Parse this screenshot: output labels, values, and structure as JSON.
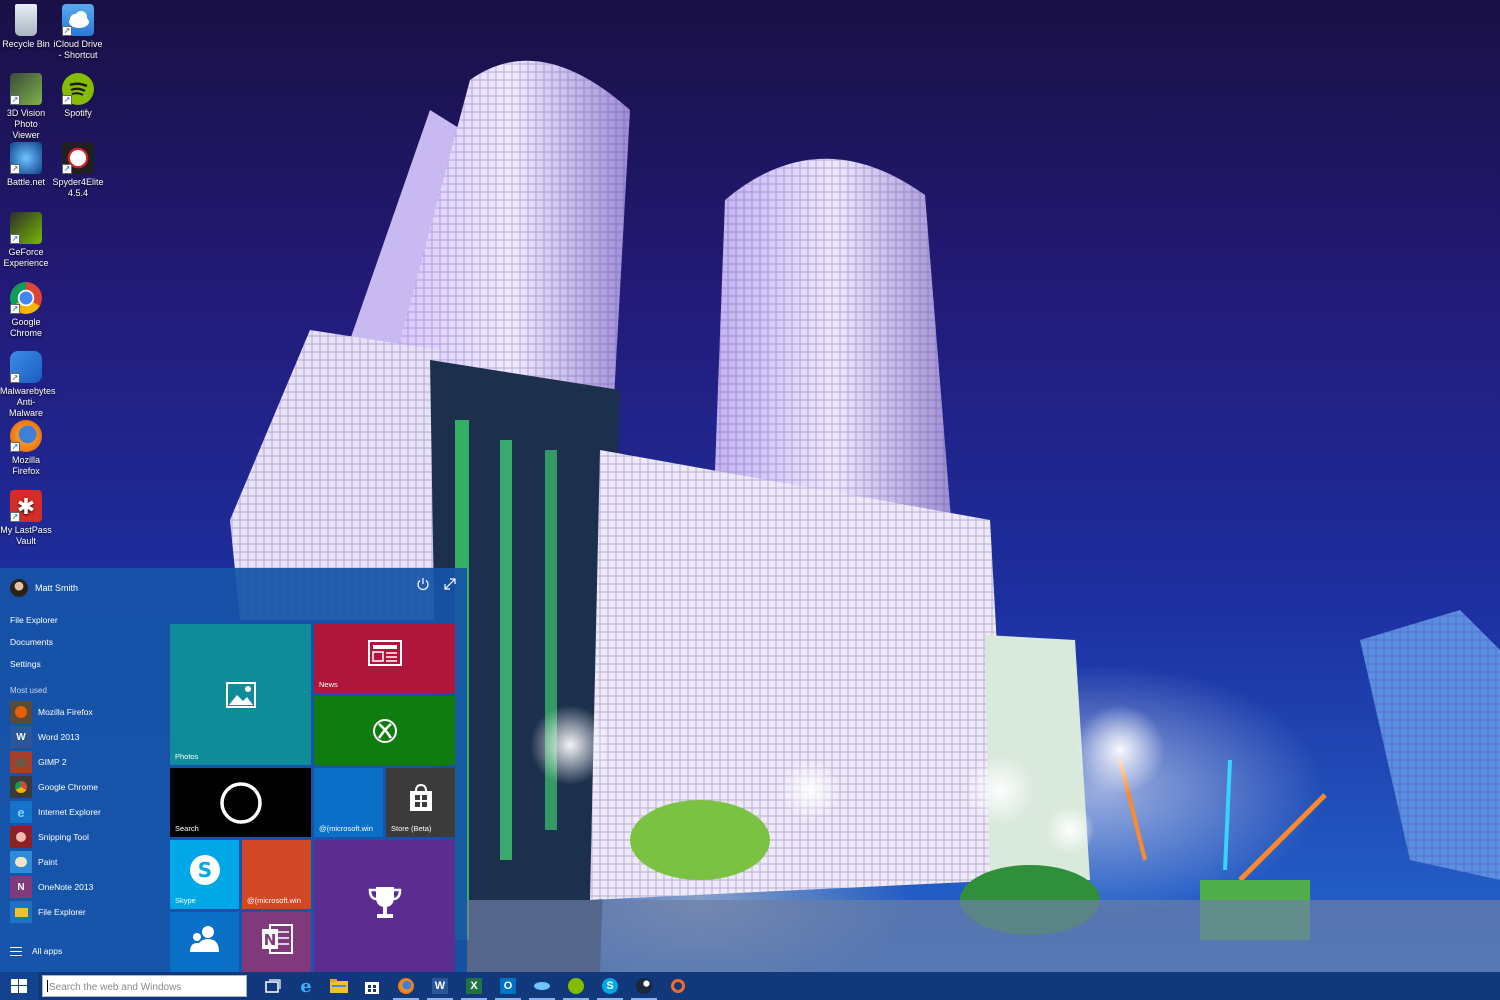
{
  "desktop": {
    "icons": [
      {
        "label": "Recycle Bin",
        "icon": "recycle-bin-icon"
      },
      {
        "label": "iCloud Drive - Shortcut",
        "icon": "icloud-icon"
      },
      {
        "label": "3D Vision Photo Viewer",
        "icon": "3d-vision-icon"
      },
      {
        "label": "Spotify",
        "icon": "spotify-icon"
      },
      {
        "label": "Battle.net",
        "icon": "battlenet-icon"
      },
      {
        "label": "Spyder4Elite 4.5.4",
        "icon": "spyder-icon"
      },
      {
        "label": "GeForce Experience",
        "icon": "geforce-icon"
      },
      {
        "label": "Google Chrome",
        "icon": "chrome-icon"
      },
      {
        "label": "Malwarebytes Anti-Malware",
        "icon": "malwarebytes-icon"
      },
      {
        "label": "Mozilla Firefox",
        "icon": "firefox-icon"
      },
      {
        "label": "My LastPass Vault",
        "icon": "lastpass-icon"
      }
    ]
  },
  "start_menu": {
    "user_name": "Matt Smith",
    "places": [
      "File Explorer",
      "Documents",
      "Settings"
    ],
    "most_used_header": "Most used",
    "most_used": [
      {
        "label": "Mozilla Firefox",
        "icon": "firefox-icon",
        "color": "#e66000"
      },
      {
        "label": "Word 2013",
        "icon": "word-icon",
        "color": "#2b579a"
      },
      {
        "label": "GIMP 2",
        "icon": "gimp-icon",
        "color": "#6b5a48"
      },
      {
        "label": "Google Chrome",
        "icon": "chrome-icon",
        "color": "#4caf50"
      },
      {
        "label": "Internet Explorer",
        "icon": "ie-icon",
        "color": "#1ea1f1"
      },
      {
        "label": "Snipping Tool",
        "icon": "snipping-tool-icon",
        "color": "#b0262b"
      },
      {
        "label": "Paint",
        "icon": "paint-icon",
        "color": "#2f8bd8"
      },
      {
        "label": "OneNote 2013",
        "icon": "onenote-icon",
        "color": "#80397b"
      },
      {
        "label": "File Explorer",
        "icon": "file-explorer-icon",
        "color": "#f0c030"
      }
    ],
    "all_apps": "All apps",
    "tiles": {
      "photos": {
        "label": "Photos",
        "color": "#0e8c9a"
      },
      "news": {
        "label": "News",
        "color": "#b0163c"
      },
      "xbox": {
        "label": "",
        "color": "#107c10"
      },
      "search": {
        "label": "Search",
        "color": "#000000"
      },
      "mail": {
        "label": "@{microsoft.win",
        "color": "#0a6fc6"
      },
      "store": {
        "label": "Store (Beta)",
        "color": "#3b3b3b"
      },
      "skype": {
        "label": "Skype",
        "color": "#00a8e8"
      },
      "calendar": {
        "label": "@{microsoft.win",
        "color": "#d24726"
      },
      "achievements": {
        "label": "",
        "color": "#5c2d91"
      },
      "people": {
        "label": "",
        "color": "#0a6fc6"
      },
      "onenote": {
        "label": "",
        "color": "#80397b"
      }
    }
  },
  "taskbar": {
    "search_placeholder": "Search the web and Windows",
    "apps": [
      {
        "name": "task-view-icon",
        "running": false
      },
      {
        "name": "internet-explorer-icon",
        "running": false
      },
      {
        "name": "file-explorer-icon",
        "running": false
      },
      {
        "name": "store-icon",
        "running": false
      },
      {
        "name": "firefox-icon",
        "running": true
      },
      {
        "name": "word-icon",
        "running": true
      },
      {
        "name": "excel-icon",
        "running": true
      },
      {
        "name": "outlook-icon",
        "running": true
      },
      {
        "name": "battlenet-icon",
        "running": true
      },
      {
        "name": "spotify-icon",
        "running": true
      },
      {
        "name": "skype-icon",
        "running": true
      },
      {
        "name": "steam-icon",
        "running": true
      },
      {
        "name": "origin-icon",
        "running": false
      }
    ]
  }
}
